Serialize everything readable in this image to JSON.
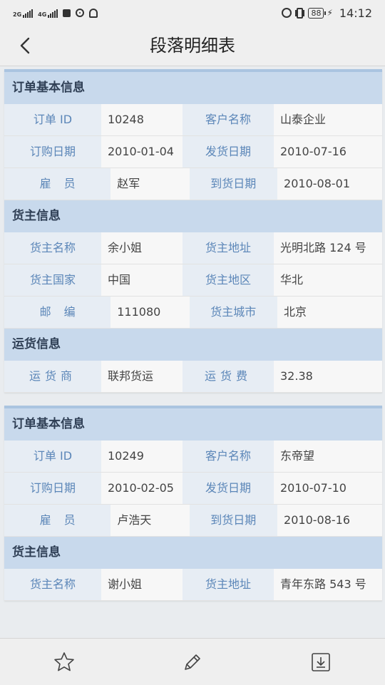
{
  "status_bar": {
    "sim1": "2G",
    "sim2": "4G",
    "battery": "88",
    "time": "14:12"
  },
  "header": {
    "title": "段落明细表"
  },
  "records": [
    {
      "sections": [
        {
          "title": "订单基本信息",
          "rows": [
            [
              {
                "label": "订单 ID",
                "value": "10248"
              },
              {
                "label": "客户名称",
                "value": "山泰企业"
              }
            ],
            [
              {
                "label": "订购日期",
                "value": "2010-01-04"
              },
              {
                "label": "发货日期",
                "value": "2010-07-16"
              }
            ],
            [
              {
                "label": "雇员",
                "value": "赵军"
              },
              {
                "label": "到货日期",
                "value": "2010-08-01"
              }
            ]
          ]
        },
        {
          "title": "货主信息",
          "rows": [
            [
              {
                "label": "货主名称",
                "value": "余小姐"
              },
              {
                "label": "货主地址",
                "value": "光明北路 124 号"
              }
            ],
            [
              {
                "label": "货主国家",
                "value": "中国"
              },
              {
                "label": "货主地区",
                "value": "华北"
              }
            ],
            [
              {
                "label": "邮编",
                "value": "111080"
              },
              {
                "label": "货主城市",
                "value": "北京"
              }
            ]
          ]
        },
        {
          "title": "运货信息",
          "rows": [
            [
              {
                "label": "运货商",
                "value": "联邦货运"
              },
              {
                "label": "运货费",
                "value": "32.38"
              }
            ]
          ]
        }
      ]
    },
    {
      "sections": [
        {
          "title": "订单基本信息",
          "rows": [
            [
              {
                "label": "订单 ID",
                "value": "10249"
              },
              {
                "label": "客户名称",
                "value": "东帝望"
              }
            ],
            [
              {
                "label": "订购日期",
                "value": "2010-02-05"
              },
              {
                "label": "发货日期",
                "value": "2010-07-10"
              }
            ],
            [
              {
                "label": "雇员",
                "value": "卢浩天"
              },
              {
                "label": "到货日期",
                "value": "2010-08-16"
              }
            ]
          ]
        },
        {
          "title": "货主信息",
          "rows": [
            [
              {
                "label": "货主名称",
                "value": "谢小姐"
              },
              {
                "label": "货主地址",
                "value": "青年东路 543 号"
              }
            ]
          ]
        }
      ]
    }
  ],
  "toolbar": {
    "items": [
      {
        "icon": "star-icon"
      },
      {
        "icon": "pencil-icon"
      },
      {
        "icon": "download-icon"
      }
    ]
  },
  "colors": {
    "section_header_bg": "#c8d9ec",
    "label_text": "#5b86b8",
    "card_top_border": "#aac4e0"
  }
}
